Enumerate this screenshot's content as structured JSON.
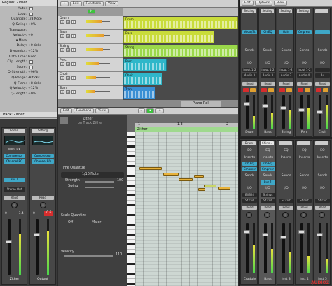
{
  "inspector": {
    "region_header": "Region: Zither",
    "rows": [
      {
        "label": "Mute:",
        "value": "",
        "checkbox": true
      },
      {
        "label": "Loop:",
        "value": "",
        "checkbox": true
      },
      {
        "label": "Quantize:",
        "value": "1/8 Note"
      },
      {
        "label": "Q-Swing:",
        "value": "+0%"
      },
      {
        "label": "Transpose:",
        "value": ""
      },
      {
        "label": "Velocity:",
        "value": "+0"
      },
      {
        "label": "▾ More",
        "value": ""
      },
      {
        "label": "Delay:",
        "value": "+0 ticks"
      },
      {
        "label": "Dynamics:",
        "value": "+12%"
      },
      {
        "label": "Gate Time:",
        "value": "Fixed"
      },
      {
        "label": "Clip Length:",
        "value": "",
        "checkbox": true
      },
      {
        "label": "Score:",
        "value": "",
        "checkbox": true
      },
      {
        "label": "Q-Strength:",
        "value": "+96%"
      },
      {
        "label": "Q-Range:",
        "value": "-8 ticks"
      },
      {
        "label": "Q-Flam:",
        "value": "+8 ticks"
      },
      {
        "label": "Q-Velocity:",
        "value": "+12%"
      },
      {
        "label": "Q-Length:",
        "value": "+0%"
      }
    ],
    "track_header": "Track: Zither",
    "strip1": {
      "setting": "Choose...",
      "midi_fx": "MIDI FX",
      "plugins": [
        "Compressor",
        "Channel EQ"
      ],
      "sends": [
        "Bus 1"
      ],
      "output": "Stereo Out",
      "automation": "Read",
      "vol_a": "0",
      "vol_b": "-3.4",
      "name": "Zither"
    },
    "strip2": {
      "setting": "Setting",
      "plugins": [
        "Compressor",
        "Channel EQ"
      ],
      "automation": "Read",
      "vol_a": "0",
      "vol_b": "-0.6",
      "name": "Output"
    }
  },
  "arrange": {
    "menus": [
      "Edit",
      "Functions",
      "View"
    ],
    "tracks": [
      {
        "name": "Drum",
        "region": "Drum",
        "color": "#c9dc3a"
      },
      {
        "name": "Bass",
        "region": "Bass",
        "color": "#c9dc3a"
      },
      {
        "name": "String",
        "region": "String",
        "color": "#9ad84a"
      },
      {
        "name": "Perc",
        "region": "Perc",
        "color": "#2fb7c9"
      },
      {
        "name": "Choir",
        "region": "Choir",
        "color": "#2fb7c9"
      },
      {
        "name": "Tran",
        "region": "Tran",
        "color": "#3a8fd4"
      }
    ]
  },
  "piano_roll": {
    "tab": "Piano Roll",
    "menus": [
      "Edit",
      "Functions",
      "View"
    ],
    "region_name": "Zither",
    "region_sub": "on Track Zither",
    "time_quantize_label": "Time Quantize",
    "time_quantize_value": "1/16 Note",
    "strength_label": "Strength",
    "strength_value": "100",
    "swing_label": "Swing",
    "scale_quantize_label": "Scale Quantize",
    "scale_off": "Off",
    "scale_major": "Major",
    "velocity_label": "Velocity",
    "velocity_value": "110",
    "ruler_marks": [
      "1",
      "1.3",
      "2"
    ],
    "region_label": "Zither"
  },
  "mixer": {
    "menus": [
      "Edit",
      "Options",
      "View"
    ],
    "top_strips": [
      {
        "setting": "Setting",
        "plugin": "Vocal/St",
        "input": "Input 1-2",
        "output": "Audio 3",
        "name": "Drum"
      },
      {
        "setting": "Setting",
        "plugin": "Ch EQ",
        "input": "Input 1-2",
        "output": "Audio 3",
        "name": "Bass"
      },
      {
        "setting": "Setting",
        "plugin": "Gain",
        "input": "Input 1-2",
        "output": "Audio 3",
        "name": "String"
      },
      {
        "setting": "Setting",
        "plugin": "Cmpresr",
        "input": "Input 1-2",
        "output": "Audio 4",
        "name": "Perc"
      },
      {
        "setting": "",
        "plugin": "",
        "input": "",
        "output": "Au",
        "name": "Choir"
      }
    ],
    "section_labels": {
      "eq": "EQ",
      "inserts": "Inserts",
      "sends": "Sends",
      "io": "I/O"
    },
    "bottom_strips": [
      {
        "setting": "Drum",
        "plugins": [
          "Ch EQ",
          "Cmpresr"
        ],
        "send": "",
        "io": "EXS24",
        "output": "St Out",
        "name": "Cradule"
      },
      {
        "setting": "Chine...",
        "plugins": [
          "Ch EQ",
          "Cmpresr"
        ],
        "send": "Bus 1",
        "io": "Strings",
        "output": "St Out",
        "name": "Bass"
      },
      {
        "setting": "",
        "plugins": [],
        "send": "",
        "io": "",
        "output": "St Out",
        "name": "Inst 3"
      },
      {
        "setting": "",
        "plugins": [],
        "send": "",
        "io": "",
        "output": "St Out",
        "name": "Inst 4"
      },
      {
        "setting": "",
        "plugins": [],
        "send": "",
        "io": "",
        "output": "St Out",
        "name": "Inst 5"
      }
    ],
    "read_label": "Read"
  },
  "watermark": "AUDIOZ",
  "colors": {
    "accent_blue": "#3fa7c7",
    "record_red": "#d62d2d",
    "note_orange": "#e8b23a"
  }
}
